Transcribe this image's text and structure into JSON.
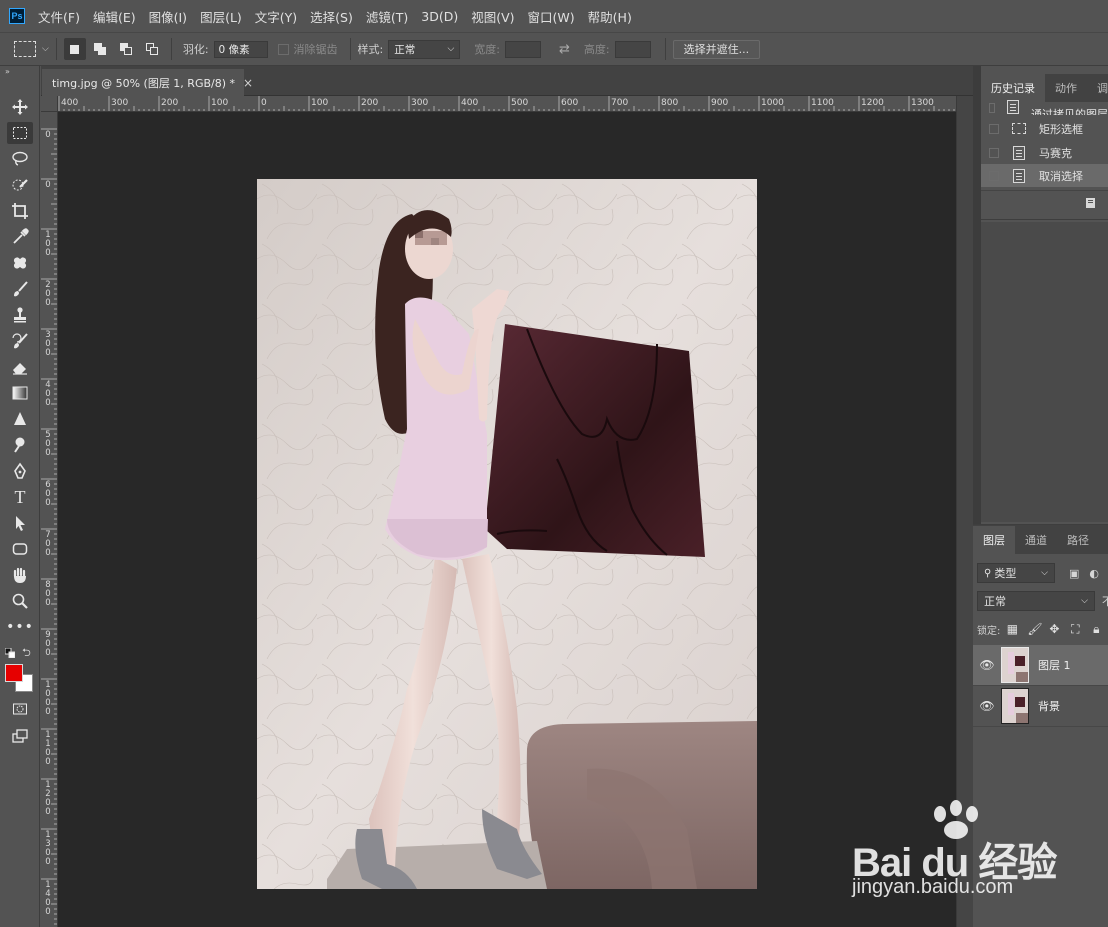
{
  "app": {
    "logo": "Ps"
  },
  "menu": [
    "文件(F)",
    "编辑(E)",
    "图像(I)",
    "图层(L)",
    "文字(Y)",
    "选择(S)",
    "滤镜(T)",
    "3D(D)",
    "视图(V)",
    "窗口(W)",
    "帮助(H)"
  ],
  "options": {
    "feather_label": "羽化:",
    "feather_value": "0 像素",
    "antialias_label": "消除锯齿",
    "style_label": "样式:",
    "style_value": "正常",
    "width_label": "宽度:",
    "height_label": "高度:",
    "select_mask_button": "选择并遮住..."
  },
  "document": {
    "tab_title": "timg.jpg @ 50% (图层 1, RGB/8) *",
    "close": "×"
  },
  "rulers": {
    "top": [
      "400",
      "300",
      "200",
      "100",
      "0",
      "100",
      "200",
      "300",
      "400",
      "500",
      "600",
      "700",
      "800",
      "900",
      "1000",
      "1100",
      "1200",
      "1300"
    ],
    "left": [
      "0",
      "0",
      "1 0 0",
      "2 0 0",
      "3 0 0",
      "4 0 0",
      "5 0 0",
      "6 0 0",
      "7 0 0",
      "8 0 0",
      "9 0 0",
      "1 0 0 0",
      "1 1 0 0",
      "1 2 0 0",
      "1 3 0 0",
      "1 4 0 0"
    ]
  },
  "history": {
    "tabs": [
      "历史记录",
      "动作",
      "调"
    ],
    "items": [
      {
        "label": "通过拷贝的图层",
        "icon": "document-icon"
      },
      {
        "label": "矩形选框",
        "icon": "marquee-icon"
      },
      {
        "label": "马赛克",
        "icon": "document-icon"
      },
      {
        "label": "取消选择",
        "icon": "document-icon"
      }
    ]
  },
  "layers": {
    "tabs": [
      "图层",
      "通道",
      "路径"
    ],
    "filter_kind": "类型",
    "blend_mode": "正常",
    "opacity_label": "不",
    "lock_label": "锁定:",
    "items": [
      {
        "name": "图层 1",
        "selected": true
      },
      {
        "name": "背景",
        "selected": false
      }
    ]
  },
  "colors": {
    "foreground": "#e60000",
    "background": "#ffffff",
    "accent": "#31a8ff"
  },
  "watermark": {
    "logo": "Bai du 经验",
    "url": "jingyan.baidu.com"
  }
}
